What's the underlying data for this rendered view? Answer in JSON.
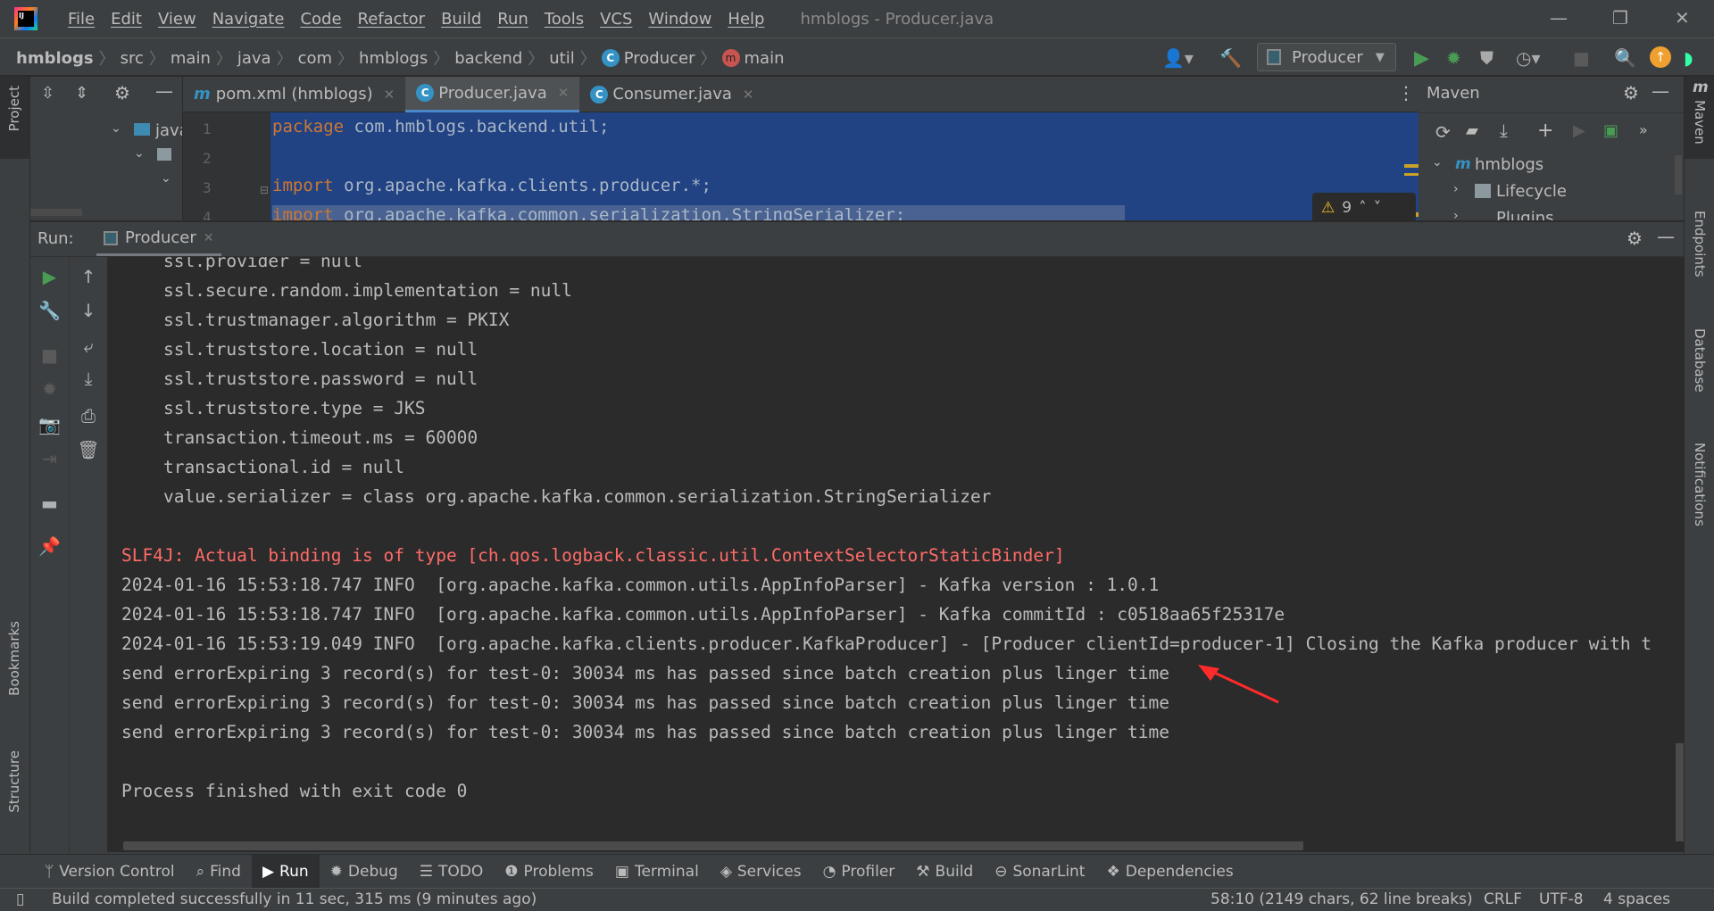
{
  "window": {
    "title": "hmblogs - Producer.java"
  },
  "menu": [
    "File",
    "Edit",
    "View",
    "Navigate",
    "Code",
    "Refactor",
    "Build",
    "Run",
    "Tools",
    "VCS",
    "Window",
    "Help"
  ],
  "breadcrumb": [
    "hmblogs",
    "src",
    "main",
    "java",
    "com",
    "hmblogs",
    "backend",
    "util",
    "Producer",
    "main"
  ],
  "toolbar": {
    "run_config": "Producer"
  },
  "left_strip": {
    "project": "Project",
    "bookmarks": "Bookmarks",
    "structure": "Structure"
  },
  "right_strip": {
    "maven": "Maven",
    "endpoints": "Endpoints",
    "database": "Database",
    "notifications": "Notifications"
  },
  "project_tree": {
    "folder": "java"
  },
  "editor": {
    "tabs": [
      {
        "label": "pom.xml (hmblogs)",
        "icon": "maven-icon",
        "active": false
      },
      {
        "label": "Producer.java",
        "icon": "class-icon",
        "active": true
      },
      {
        "label": "Consumer.java",
        "icon": "class-icon",
        "active": false
      }
    ],
    "line_numbers": [
      "1",
      "2",
      "3",
      "4"
    ],
    "lines": [
      {
        "kw": "package",
        "rest": " com.hmblogs.backend.util;"
      },
      {
        "kw": "",
        "rest": ""
      },
      {
        "kw": "import",
        "rest": " org.apache.kafka.clients.producer.*;"
      },
      {
        "kw": "import",
        "rest": " org.apache.kafka.common.serialization.StringSerializer;"
      }
    ],
    "warnings_count": "9"
  },
  "maven": {
    "title": "Maven",
    "tree": [
      "hmblogs",
      "Lifecycle",
      "Plugins"
    ]
  },
  "run": {
    "label": "Run:",
    "tab": "Producer",
    "console": [
      {
        "text": "    ssl.provider = null",
        "type": "out"
      },
      {
        "text": "    ssl.secure.random.implementation = null",
        "type": "out"
      },
      {
        "text": "    ssl.trustmanager.algorithm = PKIX",
        "type": "out"
      },
      {
        "text": "    ssl.truststore.location = null",
        "type": "out"
      },
      {
        "text": "    ssl.truststore.password = null",
        "type": "out"
      },
      {
        "text": "    ssl.truststore.type = JKS",
        "type": "out"
      },
      {
        "text": "    transaction.timeout.ms = 60000",
        "type": "out"
      },
      {
        "text": "    transactional.id = null",
        "type": "out"
      },
      {
        "text": "    value.serializer = class org.apache.kafka.common.serialization.StringSerializer",
        "type": "out"
      },
      {
        "text": "",
        "type": "out"
      },
      {
        "text": "SLF4J: Actual binding is of type [ch.qos.logback.classic.util.ContextSelectorStaticBinder]",
        "type": "err"
      },
      {
        "text": "2024-01-16 15:53:18.747 INFO  [org.apache.kafka.common.utils.AppInfoParser] - Kafka version : 1.0.1",
        "type": "out"
      },
      {
        "text": "2024-01-16 15:53:18.747 INFO  [org.apache.kafka.common.utils.AppInfoParser] - Kafka commitId : c0518aa65f25317e",
        "type": "out"
      },
      {
        "text": "2024-01-16 15:53:19.049 INFO  [org.apache.kafka.clients.producer.KafkaProducer] - [Producer clientId=producer-1] Closing the Kafka producer with t",
        "type": "out"
      },
      {
        "text": "send errorExpiring 3 record(s) for test-0: 30034 ms has passed since batch creation plus linger time",
        "type": "out"
      },
      {
        "text": "send errorExpiring 3 record(s) for test-0: 30034 ms has passed since batch creation plus linger time",
        "type": "out"
      },
      {
        "text": "send errorExpiring 3 record(s) for test-0: 30034 ms has passed since batch creation plus linger time",
        "type": "out"
      },
      {
        "text": "",
        "type": "out"
      },
      {
        "text": "Process finished with exit code 0",
        "type": "out"
      }
    ]
  },
  "bottom_tools": [
    {
      "label": "Version Control",
      "icon": "branch-icon"
    },
    {
      "label": "Find",
      "icon": "search-icon"
    },
    {
      "label": "Run",
      "icon": "play-icon",
      "active": true
    },
    {
      "label": "Debug",
      "icon": "bug-icon"
    },
    {
      "label": "TODO",
      "icon": "list-icon"
    },
    {
      "label": "Problems",
      "icon": "warning-icon"
    },
    {
      "label": "Terminal",
      "icon": "terminal-icon"
    },
    {
      "label": "Services",
      "icon": "services-icon"
    },
    {
      "label": "Profiler",
      "icon": "profiler-icon"
    },
    {
      "label": "Build",
      "icon": "hammer-icon"
    },
    {
      "label": "SonarLint",
      "icon": "sonarlint-icon"
    },
    {
      "label": "Dependencies",
      "icon": "dependencies-icon"
    }
  ],
  "status": {
    "message": "Build completed successfully in 11 sec, 315 ms (9 minutes ago)",
    "position": "58:10 (2149 chars, 62 line breaks)",
    "line_ending": "CRLF",
    "encoding": "UTF-8",
    "indent": "4 spaces"
  },
  "colors": {
    "error_text": "#ff6b68",
    "selection": "#214283",
    "console_bg": "#2b2b2b",
    "keyword": "#cc7832",
    "annotation_arrow": "#ff2a2a"
  }
}
